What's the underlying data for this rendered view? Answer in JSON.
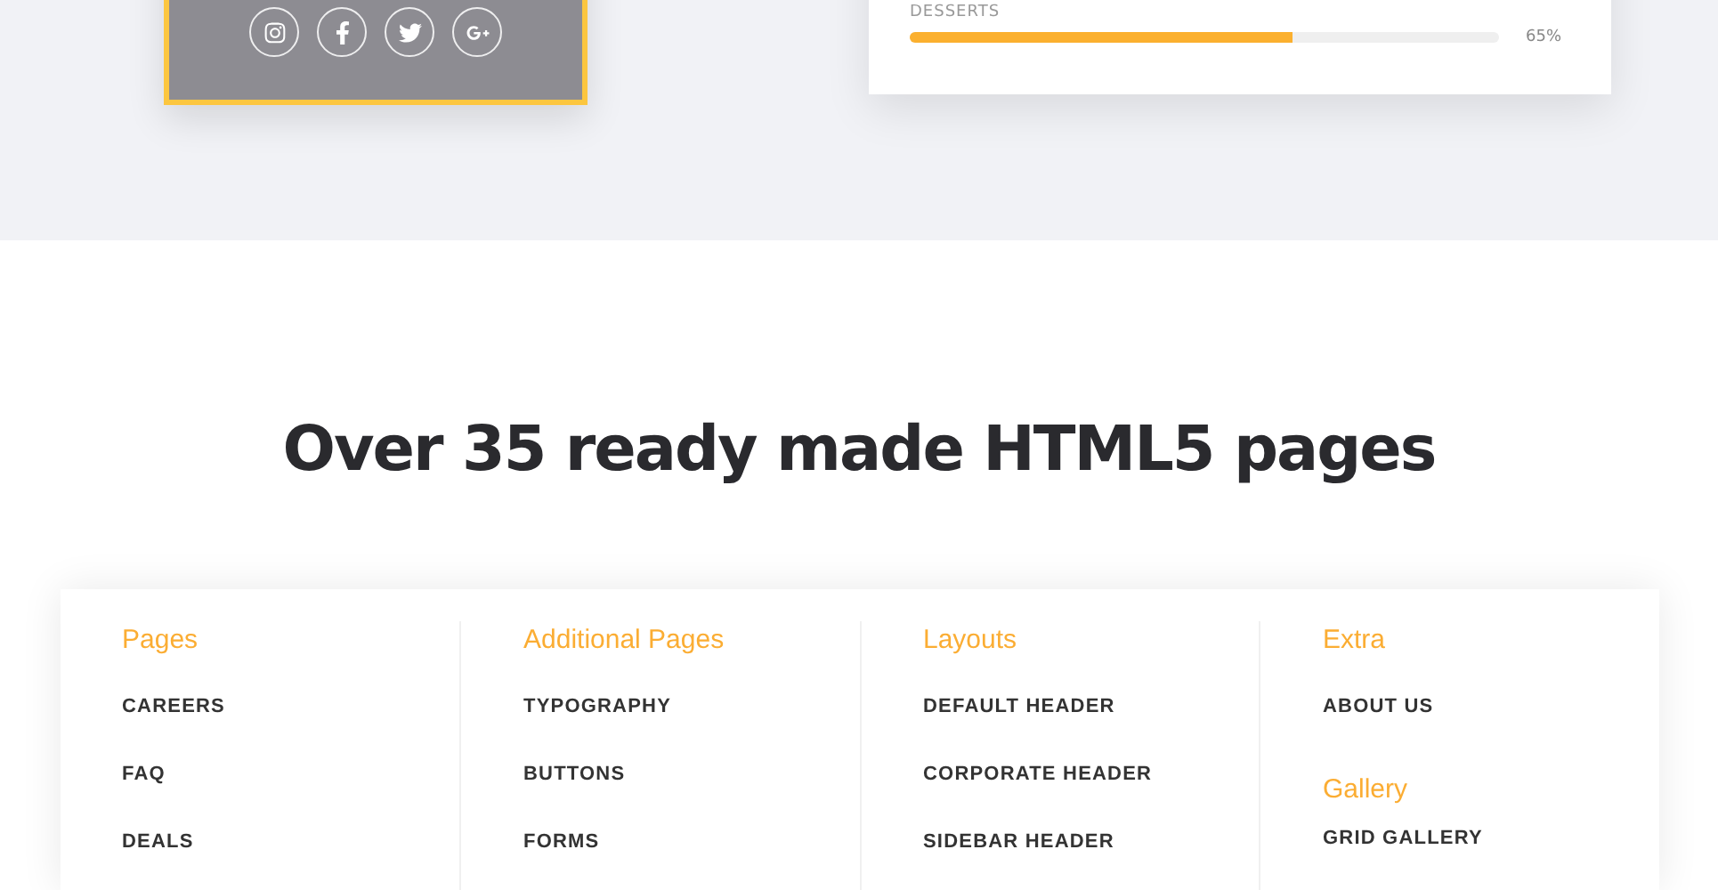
{
  "profile_card": {
    "social_links": [
      {
        "kind": "instagram"
      },
      {
        "kind": "facebook"
      },
      {
        "kind": "twitter"
      },
      {
        "kind": "google-plus"
      }
    ]
  },
  "skills_card": {
    "skills": [
      {
        "label": "DESSERTS",
        "level": 0.65,
        "reading": "65%"
      }
    ]
  },
  "pages_section": {
    "title": "Over 35 ready made HTML5 pages",
    "columns": [
      {
        "groups": [
          {
            "heading": "Pages",
            "items": [
              "CAREERS",
              "FAQ",
              "DEALS"
            ]
          }
        ]
      },
      {
        "groups": [
          {
            "heading": "Additional Pages",
            "items": [
              "TYPOGRAPHY",
              "BUTTONS",
              "FORMS"
            ]
          }
        ]
      },
      {
        "groups": [
          {
            "heading": "Layouts",
            "items": [
              "DEFAULT HEADER",
              "CORPORATE HEADER",
              "SIDEBAR HEADER"
            ]
          }
        ]
      },
      {
        "groups": [
          {
            "heading": "Extra",
            "items": [
              "ABOUT US"
            ]
          },
          {
            "heading": "Gallery",
            "items": [
              "GRID GALLERY"
            ]
          }
        ]
      }
    ]
  }
}
